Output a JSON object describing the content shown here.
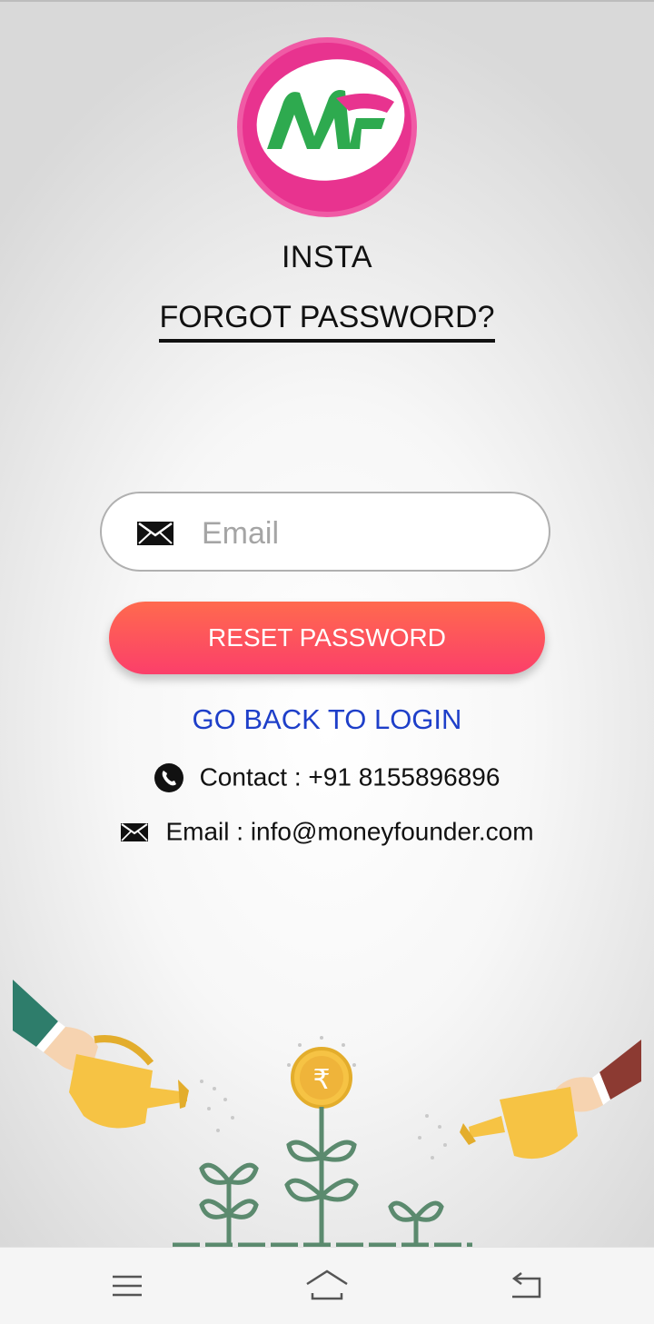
{
  "app": {
    "name": "INSTA",
    "logo_text": "MF"
  },
  "page": {
    "title": "FORGOT PASSWORD?"
  },
  "form": {
    "email_placeholder": "Email",
    "email_value": "",
    "reset_label": "RESET PASSWORD",
    "back_label": "GO BACK TO LOGIN"
  },
  "contact": {
    "phone_line": "Contact : +91 8155896896",
    "email_line": "Email : info@moneyfounder.com"
  },
  "icons": {
    "field": "mail-icon",
    "phone": "phone-icon",
    "email": "mail-icon",
    "coin": "rupee-icon"
  },
  "navbar": {
    "items": [
      "menu-icon",
      "home-icon",
      "back-icon"
    ]
  },
  "colors": {
    "accent": "#fb3f6a",
    "button_top": "#ff6a4e",
    "link": "#1e3fc9",
    "logo_ring": "#e8338f",
    "logo_green": "#2eaa4f"
  }
}
